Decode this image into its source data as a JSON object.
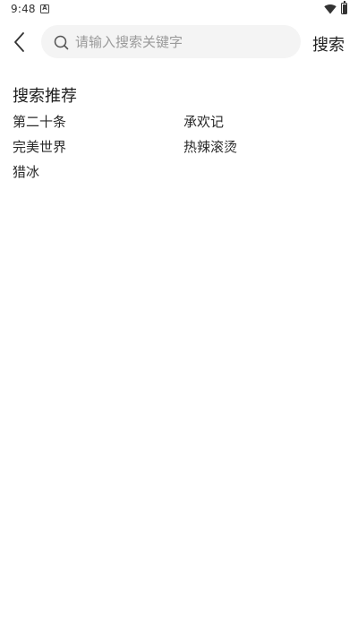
{
  "status_bar": {
    "time": "9:48",
    "notification_icon": "a-letter-icon",
    "wifi_icon": "wifi-icon",
    "battery_icon": "battery-icon"
  },
  "search": {
    "back_icon": "chevron-left-icon",
    "search_icon": "search-icon",
    "placeholder": "请输入搜索关键字",
    "value": "",
    "button_label": "搜索"
  },
  "recommend": {
    "title": "搜索推荐",
    "items": [
      "第二十条",
      "承欢记",
      "完美世界",
      "热辣滚烫",
      "猎冰"
    ]
  }
}
